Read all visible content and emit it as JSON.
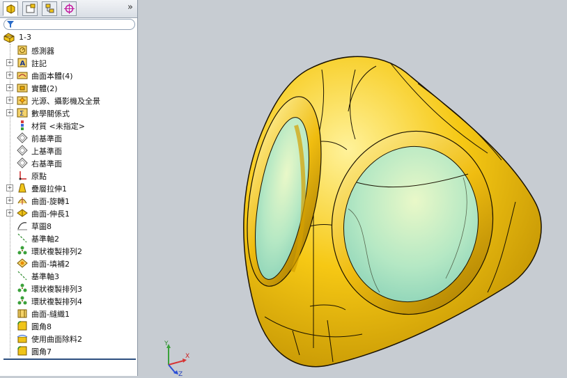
{
  "feature_tree": {
    "more_label": "»",
    "root": "1-3",
    "items": [
      {
        "label": "感測器",
        "icon": "sensor-icon",
        "expandable": false
      },
      {
        "label": "註記",
        "icon": "annotation-icon",
        "expandable": true
      },
      {
        "label": "曲面本體(4)",
        "icon": "surface-bodies-icon",
        "expandable": true
      },
      {
        "label": "實體(2)",
        "icon": "solid-bodies-icon",
        "expandable": true
      },
      {
        "label": "光源、攝影機及全景",
        "icon": "lights-camera-icon",
        "expandable": true
      },
      {
        "label": "數學關係式",
        "icon": "equations-icon",
        "expandable": true
      },
      {
        "label": "材質 <未指定>",
        "icon": "material-icon",
        "expandable": false
      },
      {
        "label": "前基準面",
        "icon": "plane-icon",
        "expandable": false
      },
      {
        "label": "上基準面",
        "icon": "plane-icon",
        "expandable": false
      },
      {
        "label": "右基準面",
        "icon": "plane-icon",
        "expandable": false
      },
      {
        "label": "原點",
        "icon": "origin-icon",
        "expandable": false
      },
      {
        "label": "疊層拉伸1",
        "icon": "loft-icon",
        "expandable": true
      },
      {
        "label": "曲面-旋轉1",
        "icon": "surface-revolve-icon",
        "expandable": true
      },
      {
        "label": "曲面-伸長1",
        "icon": "surface-extrude-icon",
        "expandable": true
      },
      {
        "label": "草圖8",
        "icon": "sketch-icon",
        "expandable": false
      },
      {
        "label": "基準軸2",
        "icon": "axis-icon",
        "expandable": false
      },
      {
        "label": "環狀複製排列2",
        "icon": "circular-pattern-icon",
        "expandable": false
      },
      {
        "label": "曲面-填補2",
        "icon": "surface-fill-icon",
        "expandable": false
      },
      {
        "label": "基準軸3",
        "icon": "axis-icon",
        "expandable": false
      },
      {
        "label": "環狀複製排列3",
        "icon": "circular-pattern-icon",
        "expandable": false
      },
      {
        "label": "環狀複製排列4",
        "icon": "circular-pattern-icon",
        "expandable": false
      },
      {
        "label": "曲面-縫織1",
        "icon": "surface-knit-icon",
        "expandable": false
      },
      {
        "label": "圓角8",
        "icon": "fillet-icon",
        "expandable": false
      },
      {
        "label": "使用曲面除料2",
        "icon": "surface-cut-icon",
        "expandable": false
      },
      {
        "label": "圓角7",
        "icon": "fillet-icon",
        "expandable": false
      }
    ]
  },
  "triad": {
    "x_label": "X",
    "y_label": "Y",
    "z_label": "Z"
  },
  "colors": {
    "model": "#f4c20d",
    "model_edge": "#1a1200",
    "glass": "#aee6c8",
    "viewport": "#c7ccd2",
    "accent": "#2d4f7f"
  }
}
